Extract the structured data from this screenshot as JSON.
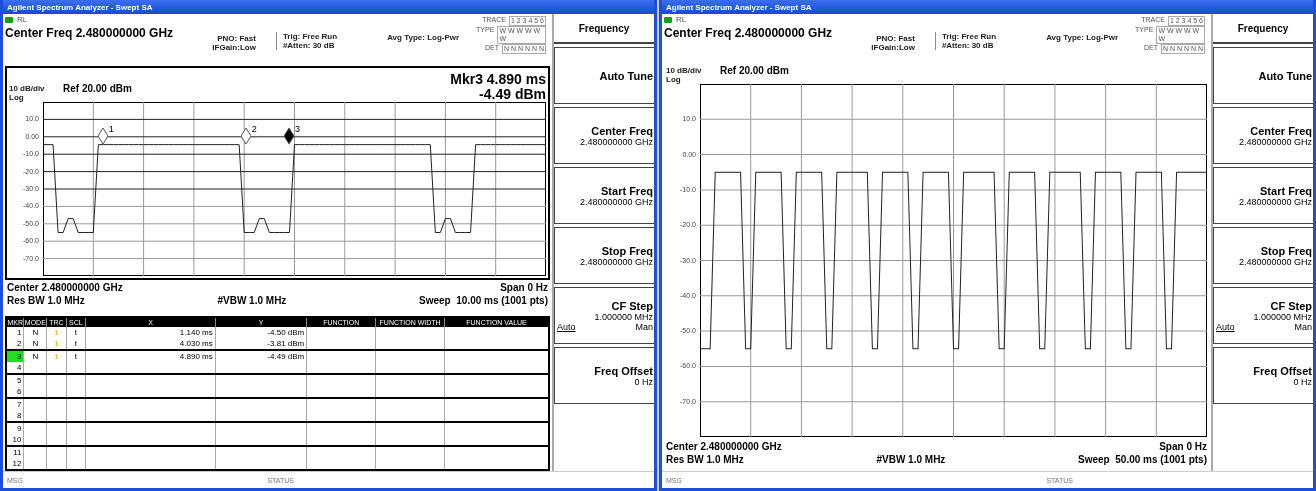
{
  "windows": [
    {
      "kind": "marker-table",
      "title": "Agilent Spectrum Analyzer - Swept SA",
      "indicator": "RL",
      "center_freq": "Center Freq 2.480000000 GHz",
      "pno": "PNO: Fast",
      "if_gain": "IFGain:Low",
      "trig": "Trig: Free Run",
      "atten": "#Atten: 30 dB",
      "avg_type": "Avg Type: Log-Pwr",
      "trace_rows": [
        {
          "label": "TRACE",
          "value": "1 2 3 4 5 6"
        },
        {
          "label": "TYPE",
          "value": "W W W W W W"
        },
        {
          "label": "DET",
          "value": "N N N N N N"
        }
      ],
      "marker_readout": [
        "Mkr3 4.890 ms",
        "-4.49 dBm"
      ],
      "scale": "10 dB/div",
      "ref": "Ref 20.00 dBm",
      "log": "Log",
      "chart_data": {
        "type": "line",
        "ylim": [
          -80,
          20
        ],
        "grid": true,
        "yticks": [
          {
            "value": 10,
            "label": "10.0"
          },
          {
            "value": 0,
            "label": "0.00"
          },
          {
            "value": -10,
            "label": "-10.0"
          },
          {
            "value": -20,
            "label": "-20.0"
          },
          {
            "value": -30,
            "label": "-30.0"
          },
          {
            "value": -40,
            "label": "-40.0"
          },
          {
            "value": -50,
            "label": "-50.0"
          },
          {
            "value": -60,
            "label": "-60.0"
          },
          {
            "value": -70,
            "label": "-70.0"
          }
        ],
        "categories": [
          null,
          null,
          null,
          null,
          null,
          null,
          null,
          null,
          null,
          null,
          null,
          null,
          null,
          null,
          null,
          null,
          null,
          null,
          null,
          null,
          null,
          null,
          null,
          null,
          null,
          null,
          null,
          null,
          null,
          null,
          null,
          null,
          null,
          null,
          null,
          null,
          null,
          null,
          null,
          null,
          null,
          null,
          null,
          null,
          null,
          null,
          null,
          null,
          null,
          null,
          null,
          null,
          null,
          null,
          null,
          null,
          null,
          null,
          null,
          null,
          null,
          null,
          null,
          null,
          null,
          null,
          null,
          null,
          null,
          null,
          null,
          null,
          null,
          null,
          null,
          null,
          null,
          null,
          null,
          null,
          null,
          null,
          null,
          null,
          null,
          null,
          null,
          null,
          null,
          null,
          null,
          null,
          null,
          null,
          null,
          null,
          null,
          null,
          null,
          null,
          null
        ],
        "series": [
          {
            "color": "#222222",
            "values": [
              -4.5,
              -4.5,
              -4.5,
              -55,
              -55,
              -47,
              -47,
              -55,
              -55,
              -55,
              -55,
              -4.5,
              -4.5,
              -4.5,
              -4.5,
              -4.5,
              -4.5,
              -4.5,
              -4.5,
              -4.5,
              -4.5,
              -4.5,
              -4.5,
              -4.5,
              -4.5,
              -4.5,
              -4.5,
              -4.5,
              -4.5,
              -4.5,
              -4.5,
              -4.5,
              -4.5,
              -4.5,
              -4.5,
              -4.5,
              -4.5,
              -4.5,
              -4.5,
              -4.5,
              -55,
              -55,
              -55,
              -47,
              -47,
              -55,
              -55,
              -55,
              -55,
              -55,
              -4.5,
              -4.5,
              -4.5,
              -4.5,
              -4.5,
              -4.5,
              -4.5,
              -4.5,
              -4.5,
              -4.5,
              -4.5,
              -4.5,
              -4.5,
              -4.5,
              -4.5,
              -4.5,
              -4.5,
              -4.5,
              -4.5,
              -4.5,
              -4.5,
              -4.5,
              -4.5,
              -4.5,
              -4.5,
              -4.5,
              -4.5,
              -4.5,
              -55,
              -55,
              -47,
              -47,
              -55,
              -55,
              -55,
              -55,
              -4.5,
              -4.5,
              -4.5,
              -4.5,
              -4.5,
              -4.5,
              -4.5,
              -4.5,
              -4.5,
              -4.5,
              -4.5,
              -4.5,
              -4.5,
              -4.5,
              -4.5
            ]
          }
        ]
      },
      "markers": [
        {
          "label": "1",
          "selected": false
        },
        {
          "label": "2",
          "selected": false
        },
        {
          "label": "3",
          "selected": true
        }
      ],
      "footer": {
        "center": "Center 2.480000000 GHz",
        "span": "Span 0 Hz",
        "res_bw": "Res BW 1.0 MHz",
        "vbw": "#VBW 1.0 MHz",
        "sweep": "Sweep  10.00 ms (1001 pts)"
      },
      "table": {
        "columns": [
          "MKR",
          "MODE",
          "TRC",
          "SCL",
          "X",
          "Y",
          "FUNCTION",
          "FUNCTION WIDTH",
          "FUNCTION VALUE"
        ],
        "rows": [
          {
            "mkr": "1",
            "mode": "N",
            "trc": "1",
            "scl": "t",
            "x": "1.140 ms",
            "y": "-4.50 dBm",
            "selected": false
          },
          {
            "mkr": "2",
            "mode": "N",
            "trc": "1",
            "scl": "t",
            "x": "4.030 ms",
            "y": "-3.81 dBm",
            "selected": false
          },
          {
            "mkr": "3",
            "mode": "N",
            "trc": "1",
            "scl": "t",
            "x": "4.890 ms",
            "y": "-4.49 dBm",
            "selected": true
          },
          {
            "mkr": "4",
            "selected": false
          },
          {
            "mkr": "5",
            "selected": false
          },
          {
            "mkr": "6",
            "selected": false
          },
          {
            "mkr": "7",
            "selected": false
          },
          {
            "mkr": "8",
            "selected": false
          },
          {
            "mkr": "9",
            "selected": false
          },
          {
            "mkr": "10",
            "selected": false
          },
          {
            "mkr": "11",
            "selected": false
          },
          {
            "mkr": "12",
            "selected": false
          }
        ]
      },
      "softkeys": {
        "title": "Frequency",
        "keys": [
          {
            "kind": "plain",
            "label": "Auto Tune"
          },
          {
            "kind": "value",
            "label": "Center Freq",
            "value": "2.480000000 GHz"
          },
          {
            "kind": "value",
            "label": "Start Freq",
            "value": "2.480000000 GHz"
          },
          {
            "kind": "value",
            "label": "Stop Freq",
            "value": "2.480000000 GHz"
          },
          {
            "kind": "toggle",
            "label": "CF Step",
            "value": "1.000000 MHz",
            "options": [
              {
                "label": "Auto",
                "selected": true
              },
              {
                "label": "Man",
                "selected": false
              }
            ]
          },
          {
            "kind": "value",
            "label": "Freq Offset",
            "value": "0 Hz"
          }
        ]
      },
      "status": {
        "msg": "MSG",
        "status": "STATUS"
      }
    },
    {
      "kind": "full-graph",
      "title": "Agilent Spectrum Analyzer - Swept SA",
      "indicator": "RL",
      "center_freq": "Center Freq 2.480000000 GHz",
      "pno": "PNO: Fast",
      "if_gain": "IFGain:Low",
      "trig": "Trig: Free Run",
      "atten": "#Atten: 30 dB",
      "avg_type": "Avg Type: Log-Pwr",
      "trace_rows": [
        {
          "label": "TRACE",
          "value": "1 2 3 4 5 6"
        },
        {
          "label": "TYPE",
          "value": "W W W W W W"
        },
        {
          "label": "DET",
          "value": "N N N N N N"
        }
      ],
      "scale": "10 dB/div",
      "ref": "Ref 20.00 dBm",
      "log": "Log",
      "chart_data": {
        "type": "line",
        "ylim": [
          -80,
          20
        ],
        "grid": true,
        "yticks": [
          {
            "value": 10,
            "label": "10.0"
          },
          {
            "value": 0,
            "label": "0.00"
          },
          {
            "value": -10,
            "label": "-10.0"
          },
          {
            "value": -20,
            "label": "-20.0"
          },
          {
            "value": -30,
            "label": "-30.0"
          },
          {
            "value": -40,
            "label": "-40.0"
          },
          {
            "value": -50,
            "label": "-50.0"
          },
          {
            "value": -60,
            "label": "-60.0"
          },
          {
            "value": -70,
            "label": "-70.0"
          }
        ],
        "categories": [
          null,
          null,
          null,
          null,
          null,
          null,
          null,
          null,
          null,
          null,
          null,
          null,
          null,
          null,
          null,
          null,
          null,
          null,
          null,
          null,
          null,
          null,
          null,
          null,
          null,
          null,
          null,
          null,
          null,
          null,
          null,
          null,
          null,
          null,
          null,
          null,
          null,
          null,
          null,
          null,
          null,
          null,
          null,
          null,
          null,
          null,
          null,
          null,
          null,
          null,
          null,
          null,
          null,
          null,
          null,
          null,
          null,
          null,
          null,
          null,
          null,
          null,
          null,
          null,
          null,
          null,
          null,
          null,
          null,
          null,
          null,
          null,
          null,
          null,
          null,
          null,
          null,
          null,
          null,
          null,
          null,
          null,
          null,
          null,
          null,
          null,
          null,
          null,
          null,
          null,
          null,
          null,
          null,
          null,
          null,
          null,
          null,
          null,
          null,
          null,
          null
        ],
        "series": [
          {
            "color": "#222222",
            "values": [
              -55,
              -55,
              -55,
              -5,
              -5,
              -5,
              -5,
              -5,
              -5,
              -55,
              -55,
              -5,
              -5,
              -5,
              -5,
              -5,
              -5,
              -55,
              -55,
              -5,
              -5,
              -5,
              -5,
              -5,
              -5,
              -55,
              -55,
              -5,
              -5,
              -5,
              -5,
              -5,
              -5,
              -5,
              -55,
              -55,
              -5,
              -5,
              -5,
              -5,
              -5,
              -5,
              -55,
              -55,
              -5,
              -5,
              -5,
              -5,
              -5,
              -5,
              -55,
              -55,
              -5,
              -5,
              -5,
              -5,
              -5,
              -5,
              -5,
              -55,
              -55,
              -5,
              -5,
              -5,
              -5,
              -5,
              -5,
              -55,
              -55,
              -5,
              -5,
              -5,
              -5,
              -5,
              -5,
              -5,
              -55,
              -55,
              -5,
              -5,
              -5,
              -5,
              -5,
              -5,
              -55,
              -55,
              -5,
              -5,
              -5,
              -5,
              -5,
              -5,
              -55,
              -55,
              -5,
              -5,
              -5,
              -5,
              -5,
              -5,
              -5
            ]
          }
        ]
      },
      "footer": {
        "center": "Center 2.480000000 GHz",
        "span": "Span 0 Hz",
        "res_bw": "Res BW 1.0 MHz",
        "vbw": "#VBW 1.0 MHz",
        "sweep": "Sweep  50.00 ms (1001 pts)"
      },
      "softkeys": {
        "title": "Frequency",
        "keys": [
          {
            "kind": "plain",
            "label": "Auto Tune"
          },
          {
            "kind": "value",
            "label": "Center Freq",
            "value": "2.480000000 GHz"
          },
          {
            "kind": "value",
            "label": "Start Freq",
            "value": "2.480000000 GHz"
          },
          {
            "kind": "value",
            "label": "Stop Freq",
            "value": "2.480000000 GHz"
          },
          {
            "kind": "toggle",
            "label": "CF Step",
            "value": "1.000000 MHz",
            "options": [
              {
                "label": "Auto",
                "selected": true
              },
              {
                "label": "Man",
                "selected": false
              }
            ]
          },
          {
            "kind": "value",
            "label": "Freq Offset",
            "value": "0 Hz"
          }
        ]
      },
      "status": {
        "msg": "MSG",
        "status": "STATUS"
      }
    }
  ]
}
